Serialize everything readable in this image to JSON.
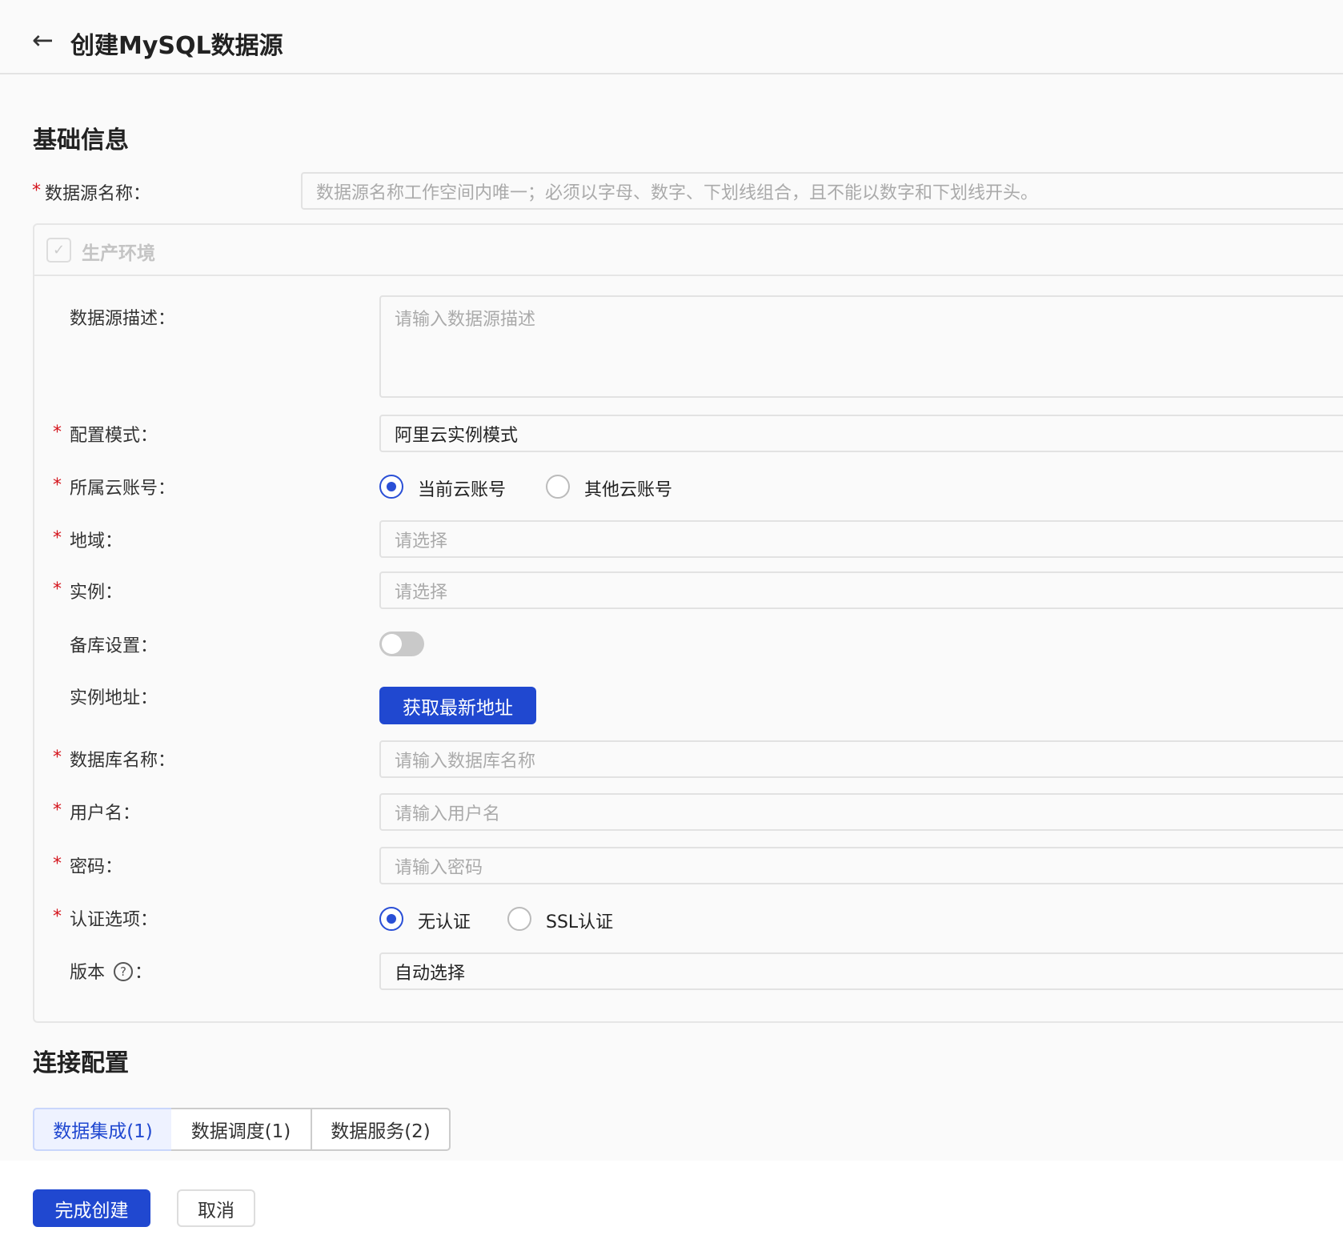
{
  "header": {
    "title": "创建MySQL数据源"
  },
  "basic": {
    "title": "基础信息",
    "name_label": "数据源名称：",
    "name_placeholder": "数据源名称工作空间内唯一；必须以字母、数字、下划线组合，且不能以数字和下划线开头。",
    "env_label": "生产环境",
    "desc_label": "数据源描述：",
    "desc_placeholder": "请输入数据源描述",
    "mode_label": "配置模式：",
    "mode_value": "阿里云实例模式",
    "account_label": "所属云账号：",
    "account_options": [
      "当前云账号",
      "其他云账号"
    ],
    "region_label": "地域：",
    "region_placeholder": "请选择",
    "instance_label": "实例：",
    "instance_placeholder": "请选择",
    "backup_label": "备库设置：",
    "address_label": "实例地址：",
    "address_button": "获取最新地址",
    "db_label": "数据库名称：",
    "db_placeholder": "请输入数据库名称",
    "user_label": "用户名：",
    "user_placeholder": "请输入用户名",
    "pwd_label": "密码：",
    "pwd_placeholder": "请输入密码",
    "auth_label": "认证选项：",
    "auth_options": [
      "无认证",
      "SSL认证"
    ],
    "version_label": "版本",
    "version_colon": "：",
    "version_value": "自动选择",
    "required": "*"
  },
  "connection": {
    "title": "连接配置",
    "tabs": [
      "数据集成(1)",
      "数据调度(1)",
      "数据服务(2)"
    ]
  },
  "footer": {
    "submit": "完成创建",
    "cancel": "取消"
  }
}
